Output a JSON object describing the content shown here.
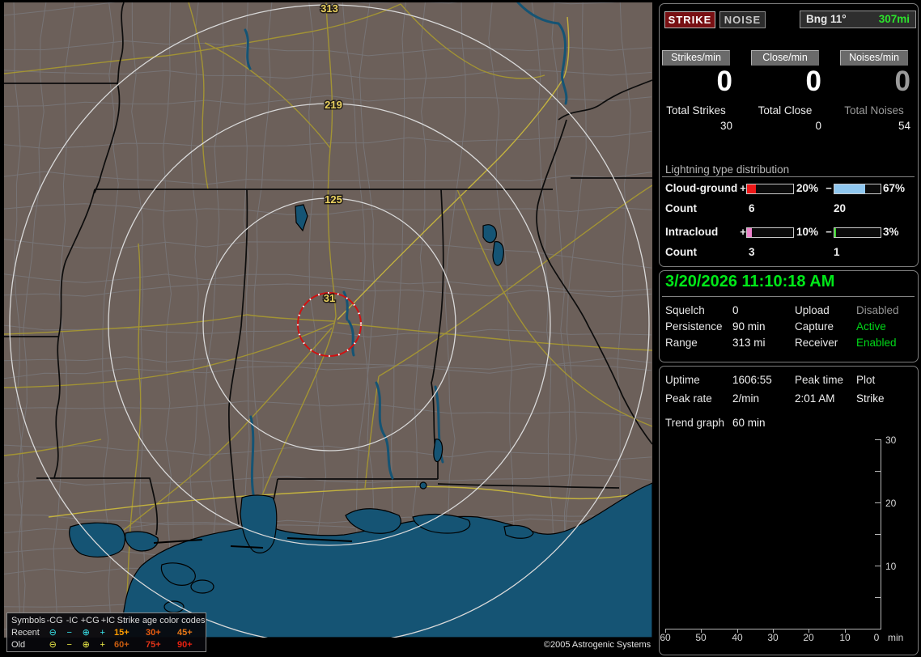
{
  "header": {
    "strike_button": "STRIKE",
    "noise_button": "NOISE",
    "bearing": "Bng 11°",
    "range": "307mi"
  },
  "counters": {
    "columns": [
      {
        "button": "Strikes/min",
        "rate": "0",
        "total_label": "Total Strikes",
        "total_value": "30"
      },
      {
        "button": "Close/min",
        "rate": "0",
        "total_label": "Total Close",
        "total_value": "0"
      },
      {
        "button": "Noises/min",
        "rate": "0",
        "total_label": "Total Noises",
        "total_value": "54"
      }
    ]
  },
  "distribution": {
    "title": "Lightning type distribution",
    "rows": [
      {
        "label": "Cloud-ground",
        "plus_sign": "+",
        "plus_fill": 20,
        "plus_color": "#ee1818",
        "plus_pct": "20%",
        "minus_sign": "−",
        "minus_fill": 67,
        "minus_color": "#8fc7ef",
        "minus_pct": "67%",
        "count_label": "Count",
        "plus_count": "6",
        "minus_count": "20"
      },
      {
        "label": "Intracloud",
        "plus_sign": "+",
        "plus_fill": 10,
        "plus_color": "#ee82cc",
        "plus_pct": "10%",
        "minus_sign": "−",
        "minus_fill": 3,
        "minus_color": "#38d428",
        "minus_pct": "3%",
        "count_label": "Count",
        "plus_count": "3",
        "minus_count": "1"
      }
    ]
  },
  "clock": {
    "datetime": "3/20/2026 11:10:18 AM"
  },
  "settings": {
    "rows": [
      {
        "label": "Squelch",
        "value": "0",
        "label2": "Upload",
        "value2": "Disabled",
        "value2_color": "#949494"
      },
      {
        "label": "Persistence",
        "value": "90 min",
        "label2": "Capture",
        "value2": "Active",
        "value2_color": "#00d818"
      },
      {
        "label": "Range",
        "value": "313 mi",
        "label2": "Receiver",
        "value2": "Enabled",
        "value2_color": "#00d818"
      }
    ]
  },
  "info": {
    "rows": [
      {
        "label": "Uptime",
        "value": "1606:55",
        "label2": "Peak time",
        "value2": "Plot"
      },
      {
        "label": "Peak rate",
        "value": "2/min",
        "label2": "2:01 AM",
        "value2": "Strike"
      }
    ],
    "trend_label": "Trend graph",
    "trend_value": "60 min"
  },
  "chart_data": {
    "type": "line",
    "title": "Strike trend graph (no data plotted)",
    "series": [],
    "y_ticks": [
      "30",
      "20",
      "10"
    ],
    "ylim": [
      0,
      30
    ],
    "x_ticks": [
      "60",
      "50",
      "40",
      "30",
      "20",
      "10",
      "0"
    ],
    "x_unit": "min",
    "xlim_minutes_ago": [
      60,
      0
    ]
  },
  "map": {
    "ring_labels": [
      "313",
      "219",
      "125",
      "31"
    ],
    "copyright": "©2005 Astrogenic Systems",
    "legend": {
      "symbols_header": "Symbols",
      "symbol_cols": [
        "-CG",
        "-IC",
        "+CG",
        "+IC"
      ],
      "age_header": "Strike age color codes",
      "rows": [
        {
          "label": "Recent",
          "color": "#3ae8f0",
          "symbols": [
            "⊖",
            "−",
            "⊕",
            "+"
          ],
          "ages": [
            {
              "text": "15+",
              "color": "#ff9d00"
            },
            {
              "text": "30+",
              "color": "#e85c10"
            },
            {
              "text": "45+",
              "color": "#e87818"
            }
          ]
        },
        {
          "label": "Old",
          "color": "#f0ee48",
          "symbols": [
            "⊖",
            "−",
            "⊕",
            "+"
          ],
          "ages": [
            {
              "text": "60+",
              "color": "#c85c10"
            },
            {
              "text": "75+",
              "color": "#e03418"
            },
            {
              "text": "90+",
              "color": "#e82010"
            }
          ]
        }
      ]
    }
  }
}
